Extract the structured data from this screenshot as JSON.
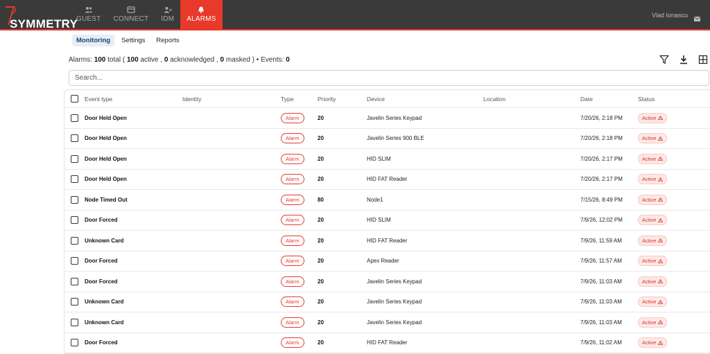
{
  "brand": {
    "name": "SYMMETRY",
    "tm": "™"
  },
  "nav": [
    {
      "id": "guest",
      "label": "GUEST",
      "icon": "guest-icon"
    },
    {
      "id": "connect",
      "label": "CONNECT",
      "icon": "connect-icon"
    },
    {
      "id": "idm",
      "label": "IDM",
      "icon": "idm-icon"
    },
    {
      "id": "alarms",
      "label": "ALARMS",
      "icon": "bell-icon",
      "active": true
    }
  ],
  "user": {
    "name": "Vlad Ionascu"
  },
  "subtabs": [
    {
      "label": "Monitoring",
      "active": true
    },
    {
      "label": "Settings"
    },
    {
      "label": "Reports"
    }
  ],
  "summary": {
    "alarms_label": "Alarms:",
    "total": "100",
    "total_label": "total",
    "active": "100",
    "active_label": "active",
    "acknowledged": "0",
    "acknowledged_label": "acknowledged",
    "masked": "0",
    "masked_label": "masked",
    "events_label": "Events:",
    "events": "0"
  },
  "search": {
    "placeholder": "Search..."
  },
  "table": {
    "headers": {
      "event_type": "Event type",
      "identity": "Identity",
      "type": "Type",
      "priority": "Priority",
      "device": "Device",
      "location": "Location",
      "date": "Date",
      "status": "Status"
    },
    "rows": [
      {
        "event": "Door Held Open",
        "identity": "",
        "type": "Alarm",
        "priority": "20",
        "device": "Javelin Series Keypad",
        "location": "",
        "date": "7/20/26, 2:18 PM",
        "status": "Active"
      },
      {
        "event": "Door Held Open",
        "identity": "",
        "type": "Alarm",
        "priority": "20",
        "device": "Javelin Series 900 BLE",
        "location": "",
        "date": "7/20/26, 2:18 PM",
        "status": "Active"
      },
      {
        "event": "Door Held Open",
        "identity": "",
        "type": "Alarm",
        "priority": "20",
        "device": "HID SLIM",
        "location": "",
        "date": "7/20/26, 2:17 PM",
        "status": "Active"
      },
      {
        "event": "Door Held Open",
        "identity": "",
        "type": "Alarm",
        "priority": "20",
        "device": "HID FAT Reader",
        "location": "",
        "date": "7/20/26, 2:17 PM",
        "status": "Active"
      },
      {
        "event": "Node Timed Out",
        "identity": "",
        "type": "Alarm",
        "priority": "80",
        "device": "Node1",
        "location": "",
        "date": "7/15/26, 8:49 PM",
        "status": "Active"
      },
      {
        "event": "Door Forced",
        "identity": "",
        "type": "Alarm",
        "priority": "20",
        "device": "HID SLIM",
        "location": "",
        "date": "7/9/26, 12:02 PM",
        "status": "Active"
      },
      {
        "event": "Unknown Card",
        "identity": "",
        "type": "Alarm",
        "priority": "20",
        "device": "HID FAT Reader",
        "location": "",
        "date": "7/9/26, 11:59 AM",
        "status": "Active"
      },
      {
        "event": "Door Forced",
        "identity": "",
        "type": "Alarm",
        "priority": "20",
        "device": "Apex Reader",
        "location": "",
        "date": "7/9/26, 11:57 AM",
        "status": "Active"
      },
      {
        "event": "Door Forced",
        "identity": "",
        "type": "Alarm",
        "priority": "20",
        "device": "Javelin Series Keypad",
        "location": "",
        "date": "7/9/26, 11:03 AM",
        "status": "Active"
      },
      {
        "event": "Unknown Card",
        "identity": "",
        "type": "Alarm",
        "priority": "20",
        "device": "Javelin Series Keypad",
        "location": "",
        "date": "7/9/26, 11:03 AM",
        "status": "Active"
      },
      {
        "event": "Unknown Card",
        "identity": "",
        "type": "Alarm",
        "priority": "20",
        "device": "Javelin Series Keypad",
        "location": "",
        "date": "7/9/26, 11:03 AM",
        "status": "Active"
      },
      {
        "event": "Door Forced",
        "identity": "",
        "type": "Alarm",
        "priority": "20",
        "device": "HID FAT Reader",
        "location": "",
        "date": "7/9/26, 11:02 AM",
        "status": "Active"
      }
    ]
  },
  "colors": {
    "accent": "#e8392b",
    "topbar": "#3a3a3a",
    "active_tab_bg": "#e7eef5"
  }
}
